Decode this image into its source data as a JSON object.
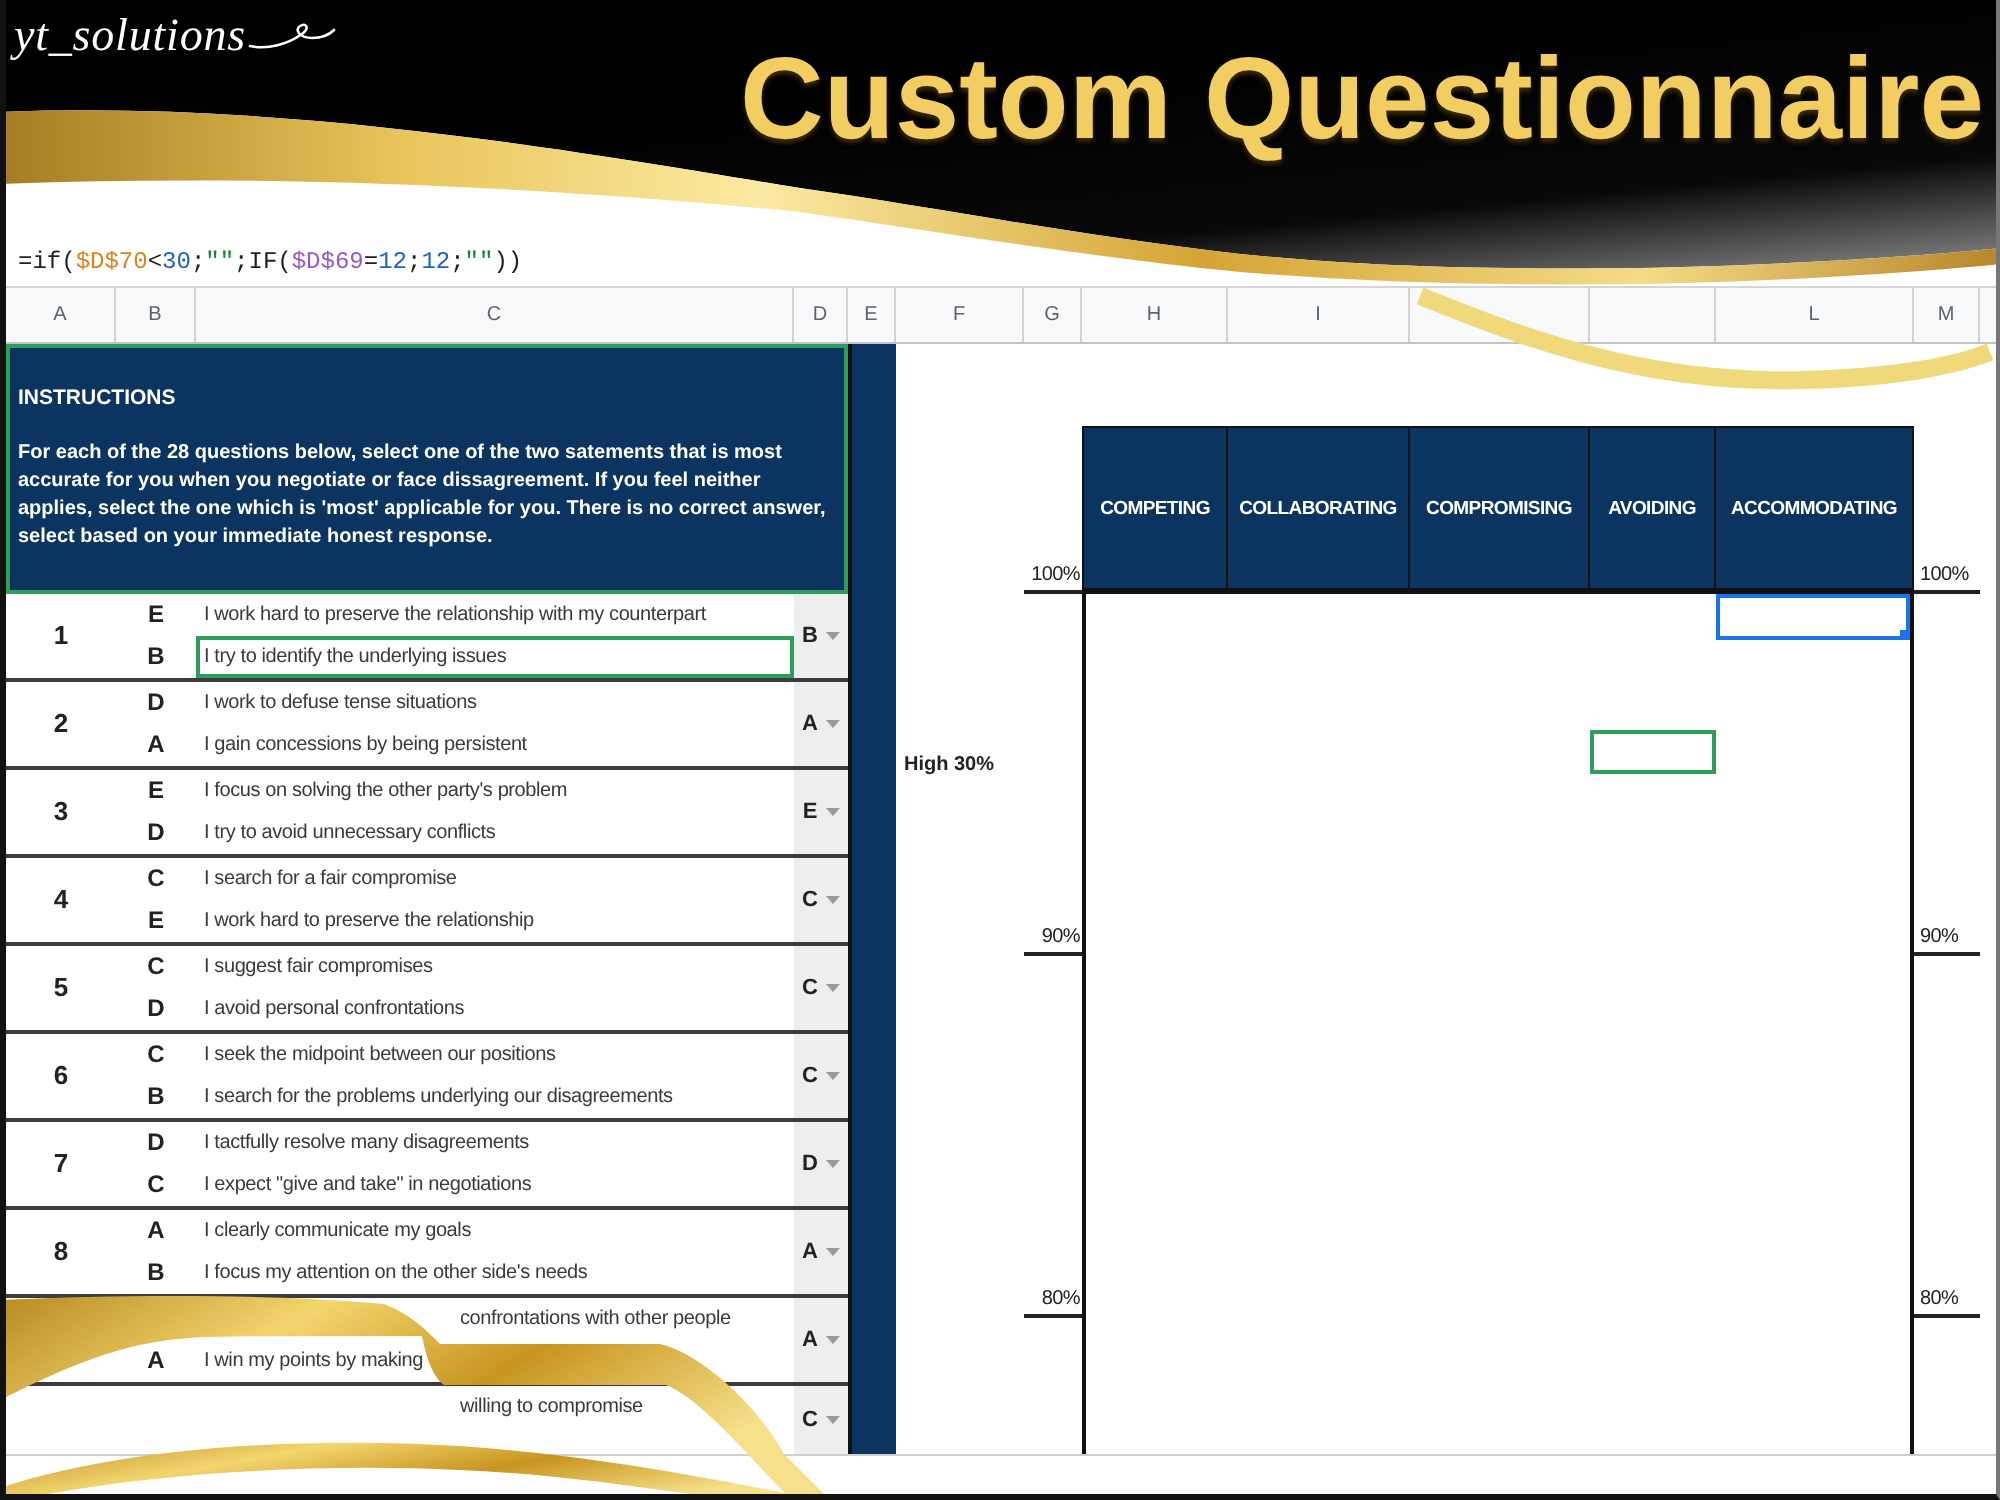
{
  "banner": {
    "logo": "yt_solutions",
    "title": "Custom Questionnaire"
  },
  "formula_bar": {
    "value": "=if($D$70<30;\"\";IF($D$69=12;12;\"\"))"
  },
  "column_headers": [
    "A",
    "B",
    "C",
    "D",
    "E",
    "F",
    "G",
    "H",
    "I",
    "L",
    "M"
  ],
  "instructions": {
    "title": "INSTRUCTIONS",
    "text": "For each of the 28 questions below, select one of the two satements that is most accurate for you when you negotiate or face dissagreement. If you feel neither applies, select the one which is 'most' applicable for you. There is no correct answer, select based on your immediate honest response.",
    "outlined": true
  },
  "questions": [
    {
      "number": "1",
      "answer": "B",
      "options": [
        {
          "kind": "full",
          "letter": "E",
          "text": "I work hard to preserve the relationship with my counterpart",
          "outlined": false
        },
        {
          "kind": "full",
          "letter": "B",
          "text": "I try to identify the underlying issues",
          "outlined": true
        }
      ]
    },
    {
      "number": "2",
      "answer": "A",
      "options": [
        {
          "kind": "full",
          "letter": "D",
          "text": "I work to defuse tense situations",
          "outlined": false
        },
        {
          "kind": "full",
          "letter": "A",
          "text": "I gain concessions by being persistent",
          "outlined": false
        }
      ]
    },
    {
      "number": "3",
      "answer": "E",
      "options": [
        {
          "kind": "full",
          "letter": "E",
          "text": "I focus on solving the other party's problem",
          "outlined": false
        },
        {
          "kind": "full",
          "letter": "D",
          "text": "I try to avoid unnecessary conflicts",
          "outlined": false
        }
      ]
    },
    {
      "number": "4",
      "answer": "C",
      "options": [
        {
          "kind": "full",
          "letter": "C",
          "text": "I search for a fair compromise",
          "outlined": false
        },
        {
          "kind": "full",
          "letter": "E",
          "text": "I work hard to preserve the relationship",
          "outlined": false
        }
      ]
    },
    {
      "number": "5",
      "answer": "C",
      "options": [
        {
          "kind": "full",
          "letter": "C",
          "text": "I suggest fair compromises",
          "outlined": false
        },
        {
          "kind": "full",
          "letter": "D",
          "text": "I avoid personal confrontations",
          "outlined": false
        }
      ]
    },
    {
      "number": "6",
      "answer": "C",
      "options": [
        {
          "kind": "full",
          "letter": "C",
          "text": "I seek the midpoint between our positions",
          "outlined": false
        },
        {
          "kind": "full",
          "letter": "B",
          "text": "I search for the problems underlying our disagreements",
          "outlined": false
        }
      ]
    },
    {
      "number": "7",
      "answer": "D",
      "options": [
        {
          "kind": "full",
          "letter": "D",
          "text": "I tactfully resolve many disagreements",
          "outlined": false
        },
        {
          "kind": "full",
          "letter": "C",
          "text": "I expect \"give and take\" in negotiations",
          "outlined": false
        }
      ]
    },
    {
      "number": "8",
      "answer": "A",
      "options": [
        {
          "kind": "full",
          "letter": "A",
          "text": "I clearly communicate my goals",
          "outlined": false
        },
        {
          "kind": "full",
          "letter": "B",
          "text": "I focus my attention on the other side's needs",
          "outlined": false
        }
      ]
    },
    {
      "answer": "A",
      "options": [
        {
          "kind": "tail",
          "text": "confrontations with other people",
          "outlined": false
        },
        {
          "kind": "head",
          "letter": "A",
          "text": "I win my points by making",
          "outlined": false
        }
      ]
    },
    {
      "answer": "C",
      "options": [
        {
          "kind": "tail",
          "text": "willing to compromise",
          "outlined": false
        }
      ]
    }
  ],
  "profile": {
    "band_label": "High 30%",
    "left_scale": [
      "100%",
      "90%",
      "80%"
    ],
    "right_scale": [
      "100%",
      "90%",
      "80%"
    ],
    "categories": [
      "COMPETING",
      "COLLABORATING",
      "COMPROMISING",
      "AVOIDING",
      "ACCOMMODATING"
    ],
    "grid_rows": [
      {
        "cells": [
          {
            "active": false,
            "outlined": false
          },
          {
            "active": false,
            "outlined": false
          },
          {
            "active": false,
            "outlined": false
          },
          {
            "active": false,
            "outlined": false
          },
          {
            "active": true,
            "outlined": false
          }
        ]
      },
      {
        "cells": [
          {
            "active": false,
            "outlined": false
          },
          {
            "active": false,
            "outlined": false
          },
          {
            "active": false,
            "outlined": false
          },
          {
            "active": false,
            "outlined": false
          },
          {
            "active": false,
            "outlined": false
          }
        ]
      },
      {
        "cells": [
          {
            "active": false,
            "outlined": false
          },
          {
            "active": false,
            "outlined": false
          },
          {
            "active": false,
            "outlined": false
          },
          {
            "active": false,
            "outlined": false
          },
          {
            "active": false,
            "outlined": false
          }
        ]
      },
      {
        "cells": [
          {
            "active": false,
            "outlined": false
          },
          {
            "active": false,
            "outlined": false
          },
          {
            "active": false,
            "outlined": false
          },
          {
            "active": false,
            "outlined": true
          },
          {
            "active": false,
            "outlined": false
          }
        ]
      }
    ]
  }
}
